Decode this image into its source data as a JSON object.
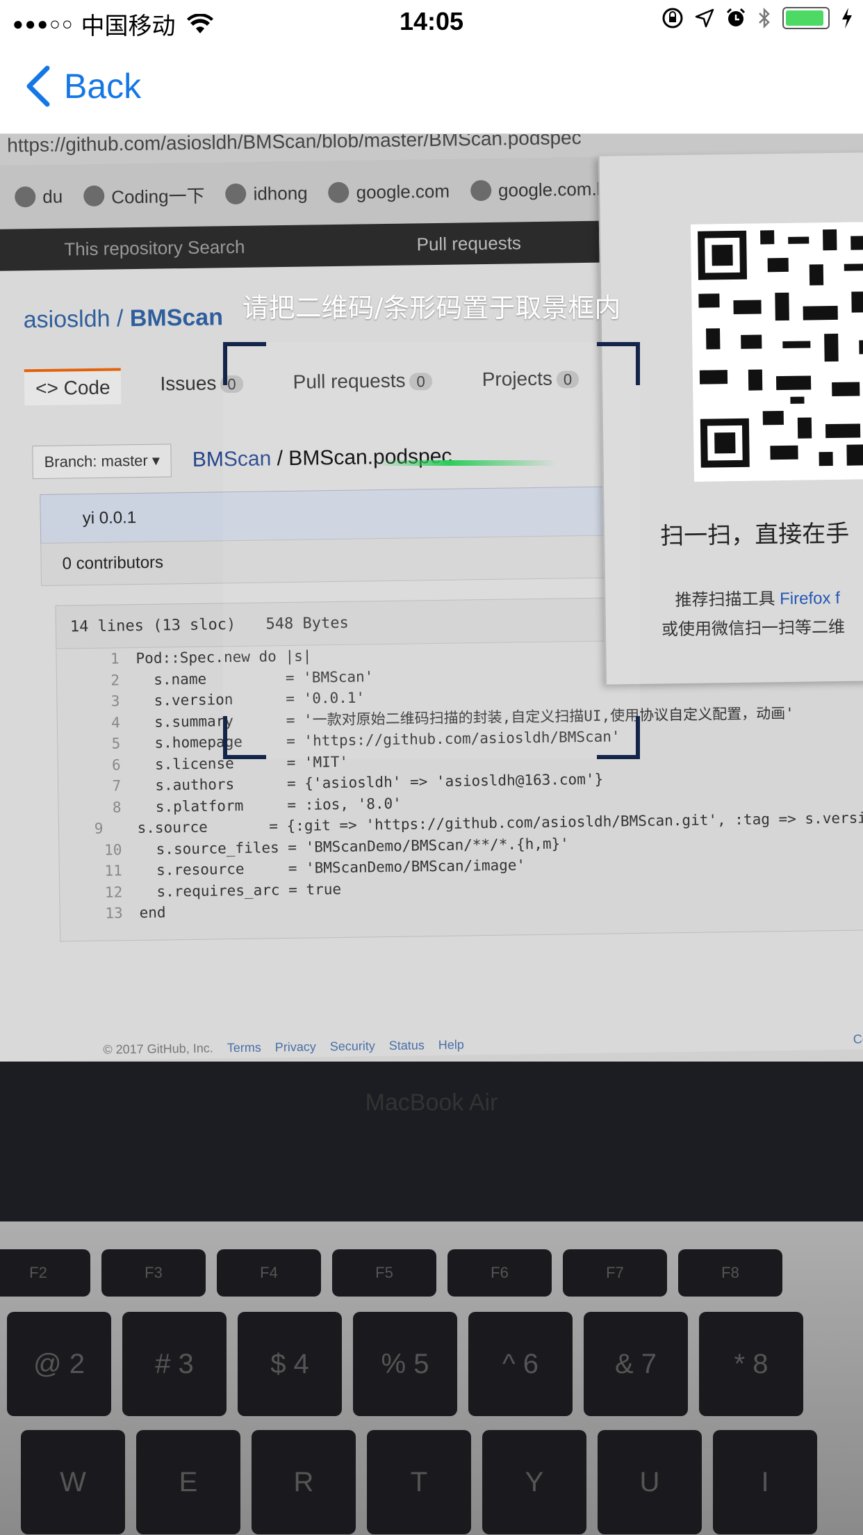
{
  "status_bar": {
    "signal": "●●●○○",
    "carrier": "中国移动",
    "time": "14:05",
    "wifi_icon": "wifi-icon",
    "battery_color": "#4cd964"
  },
  "nav": {
    "back_label": "Back",
    "tint": "#1577e5"
  },
  "scanner": {
    "hint": "请把二维码/条形码置于取景框内",
    "frame_color": "#14254a",
    "scan_line_color": "#2ccd59"
  },
  "camera_view": {
    "url": "https://github.com/asiosldh/BMScan/blob/master/BMScan.podspec",
    "bookmarks": [
      "du",
      "Coding一下",
      "idhong",
      "google.com",
      "google.com.l"
    ],
    "search_hint": "This repository   Search",
    "pull_requests": "Pull requests",
    "repo_owner": "asiosldh",
    "repo_name": "BMScan",
    "tabs": [
      {
        "label": "<> Code"
      },
      {
        "label": "Issues",
        "count": "0"
      },
      {
        "label": "Pull requests",
        "count": "0"
      },
      {
        "label": "Projects",
        "count": "0"
      }
    ],
    "branch": "Branch: master ▾",
    "file_path_repo": "BMScan",
    "file_path_file": "BMScan.podspec",
    "commit": "yi 0.0.1",
    "contributors": "0 contributors",
    "file_meta_lines": "14 lines (13 sloc)",
    "file_meta_size": "548 Bytes",
    "code_lines": [
      {
        "n": "1",
        "text": "Pod::Spec.new do |s|"
      },
      {
        "n": "2",
        "text": "  s.name         = 'BMScan'"
      },
      {
        "n": "3",
        "text": "  s.version      = '0.0.1'"
      },
      {
        "n": "4",
        "text": "  s.summary      = '一款对原始二维码扫描的封装,自定义扫描UI,使用协议自定义配置，动画'"
      },
      {
        "n": "5",
        "text": "  s.homepage     = 'https://github.com/asiosldh/BMScan'"
      },
      {
        "n": "6",
        "text": "  s.license      = 'MIT'"
      },
      {
        "n": "7",
        "text": "  s.authors      = {'asiosldh' => 'asiosldh@163.com'}"
      },
      {
        "n": "8",
        "text": "  s.platform     = :ios, '8.0'"
      },
      {
        "n": "9",
        "text": "  s.source       = {:git => 'https://github.com/asiosldh/BMScan.git', :tag => s.version}"
      },
      {
        "n": "10",
        "text": "  s.source_files = 'BMScanDemo/BMScan/**/*.{h,m}'"
      },
      {
        "n": "11",
        "text": "  s.resource     = 'BMScanDemo/BMScan/image'"
      },
      {
        "n": "12",
        "text": "  s.requires_arc = true"
      },
      {
        "n": "13",
        "text": "end"
      }
    ],
    "qr_caption": "扫一扫，直接在手",
    "qr_recommend": "推荐扫描工具",
    "qr_firefox": "Firefox f",
    "qr_alt": "或使用微信扫一扫等二维",
    "footer": [
      "© 2017 GitHub, Inc.",
      "Terms",
      "Privacy",
      "Security",
      "Status",
      "Help"
    ],
    "footer_right": "Cont",
    "bezel_label": "MacBook Air",
    "fn_keys": [
      "F2",
      "F3",
      "F4",
      "F5",
      "F6",
      "F7",
      "F8"
    ],
    "num_keys": [
      "@ 2",
      "# 3",
      "$ 4",
      "% 5",
      "^ 6",
      "& 7",
      "* 8"
    ],
    "alpha_keys": [
      "W",
      "E",
      "R",
      "T",
      "Y",
      "U",
      "I"
    ]
  }
}
